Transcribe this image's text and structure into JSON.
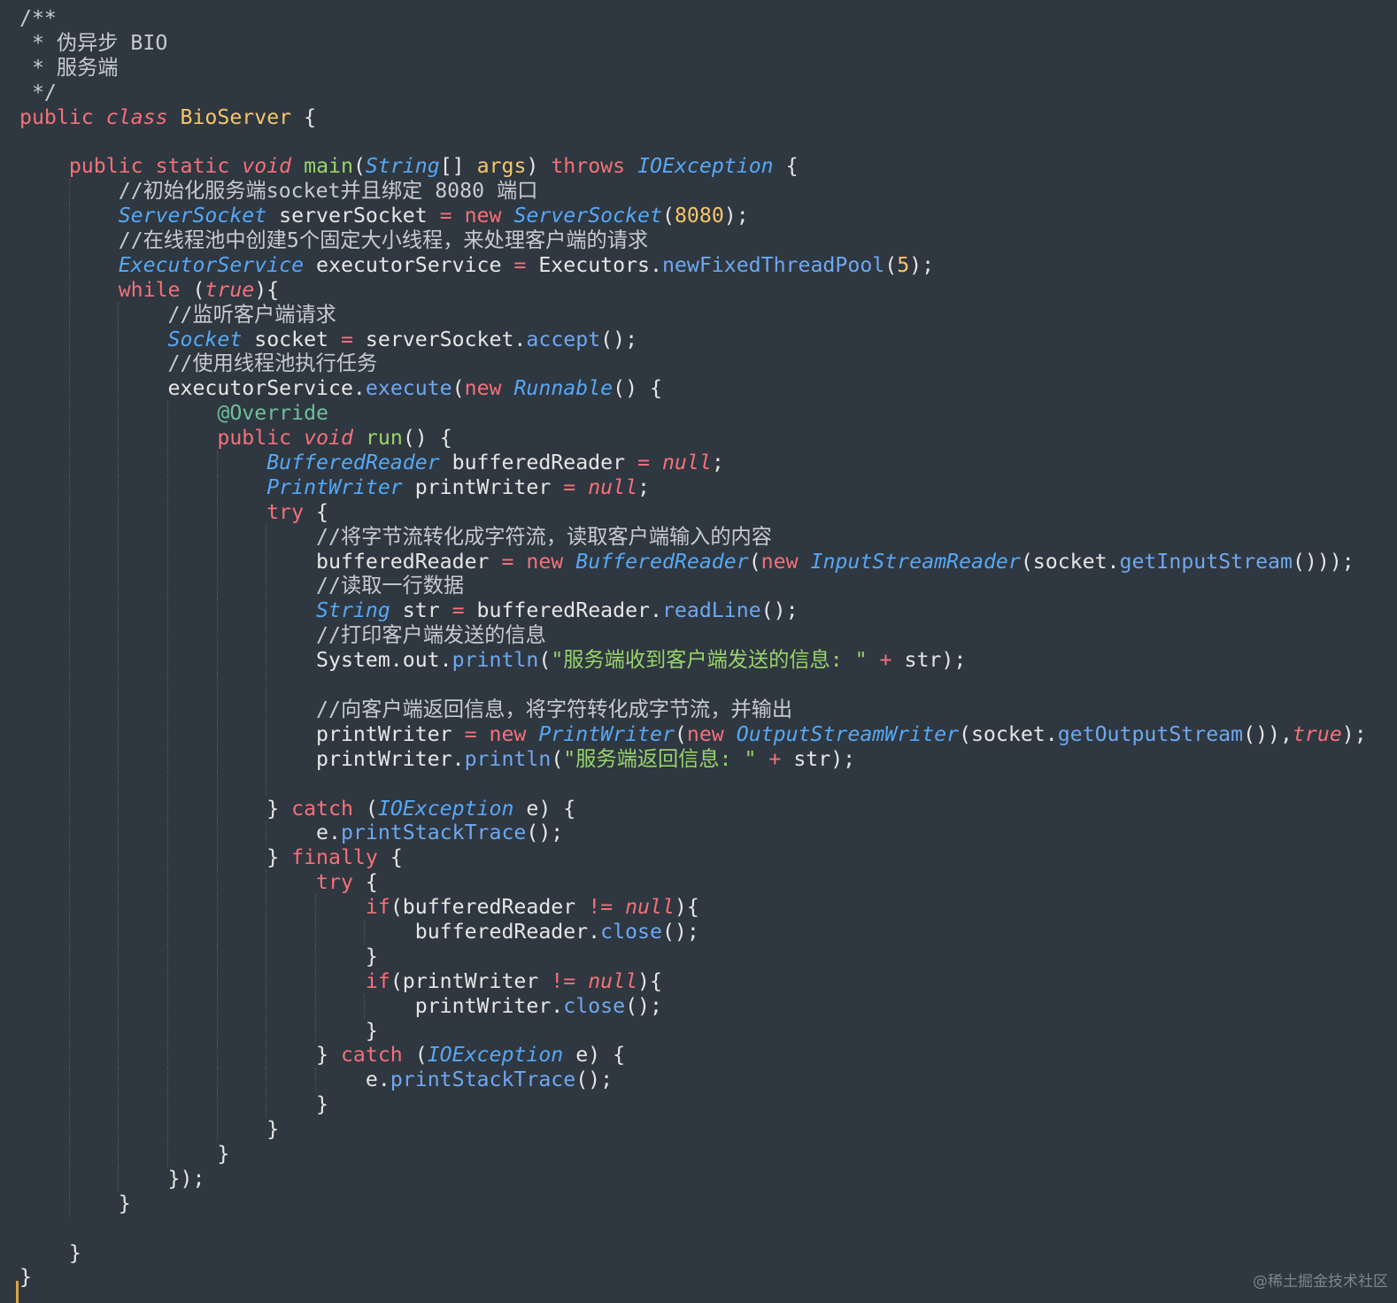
{
  "editor": {
    "language": "Java",
    "indent_size": 4,
    "colors": {
      "background": "#2f3740",
      "keyword": "#f5707a",
      "type": "#56a8f5",
      "method": "#6ea8f0",
      "declaration": "#9bd66b",
      "class_name": "#f7c66a",
      "number": "#f7c66a",
      "string": "#98d46c",
      "comment": "#c7cbd1",
      "annotation": "#6fbf9a",
      "plain": "#e6e6e6",
      "indent_guide": "#4f5863",
      "left_marker": "#d9a445"
    },
    "lines": [
      {
        "indent": 0,
        "tokens": [
          [
            "cm",
            "/**"
          ]
        ]
      },
      {
        "indent": 0,
        "tokens": [
          [
            "cm",
            " * 伪异步 BIO"
          ]
        ]
      },
      {
        "indent": 0,
        "tokens": [
          [
            "cm",
            " * 服务端"
          ]
        ]
      },
      {
        "indent": 0,
        "tokens": [
          [
            "cm",
            " */"
          ]
        ]
      },
      {
        "indent": 0,
        "tokens": [
          [
            "kw",
            "public "
          ],
          [
            "it",
            "class "
          ],
          [
            "cl",
            "BioServer"
          ],
          [
            "pl",
            " {"
          ]
        ]
      },
      {
        "indent": 0,
        "tokens": []
      },
      {
        "indent": 1,
        "tokens": [
          [
            "kw",
            "public static "
          ],
          [
            "it",
            "void "
          ],
          [
            "fm",
            "main"
          ],
          [
            "pl",
            "("
          ],
          [
            "ty",
            "String"
          ],
          [
            "pl",
            "[] "
          ],
          [
            "ar",
            "args"
          ],
          [
            "pl",
            ") "
          ],
          [
            "kw",
            "throws "
          ],
          [
            "ty",
            "IOException"
          ],
          [
            "pl",
            " {"
          ]
        ]
      },
      {
        "indent": 2,
        "tokens": [
          [
            "cm",
            "//初始化服务端socket并且绑定 8080 端口"
          ]
        ]
      },
      {
        "indent": 2,
        "tokens": [
          [
            "ty",
            "ServerSocket"
          ],
          [
            "pl",
            " serverSocket "
          ],
          [
            "op",
            "="
          ],
          [
            "kw",
            " new "
          ],
          [
            "ty",
            "ServerSocket"
          ],
          [
            "pl",
            "("
          ],
          [
            "num",
            "8080"
          ],
          [
            "pl",
            ");"
          ]
        ]
      },
      {
        "indent": 2,
        "tokens": [
          [
            "cm",
            "//在线程池中创建5个固定大小线程，来处理客户端的请求"
          ]
        ]
      },
      {
        "indent": 2,
        "tokens": [
          [
            "ty",
            "ExecutorService"
          ],
          [
            "pl",
            " executorService "
          ],
          [
            "op",
            "="
          ],
          [
            "pl",
            " Executors."
          ],
          [
            "fn",
            "newFixedThreadPool"
          ],
          [
            "pl",
            "("
          ],
          [
            "num",
            "5"
          ],
          [
            "pl",
            ");"
          ]
        ]
      },
      {
        "indent": 2,
        "tokens": [
          [
            "kw",
            "while "
          ],
          [
            "pl",
            "("
          ],
          [
            "it",
            "true"
          ],
          [
            "pl",
            "){"
          ]
        ]
      },
      {
        "indent": 3,
        "tokens": [
          [
            "cm",
            "//监听客户端请求"
          ]
        ]
      },
      {
        "indent": 3,
        "tokens": [
          [
            "ty",
            "Socket"
          ],
          [
            "pl",
            " socket "
          ],
          [
            "op",
            "="
          ],
          [
            "pl",
            " serverSocket."
          ],
          [
            "fn",
            "accept"
          ],
          [
            "pl",
            "();"
          ]
        ]
      },
      {
        "indent": 3,
        "tokens": [
          [
            "cm",
            "//使用线程池执行任务"
          ]
        ]
      },
      {
        "indent": 3,
        "tokens": [
          [
            "pl",
            "executorService."
          ],
          [
            "fn",
            "execute"
          ],
          [
            "pl",
            "("
          ],
          [
            "kw",
            "new "
          ],
          [
            "ty",
            "Runnable"
          ],
          [
            "pl",
            "() {"
          ]
        ]
      },
      {
        "indent": 4,
        "tokens": [
          [
            "an",
            "@Override"
          ]
        ]
      },
      {
        "indent": 4,
        "tokens": [
          [
            "kw",
            "public "
          ],
          [
            "it",
            "void "
          ],
          [
            "fm",
            "run"
          ],
          [
            "pl",
            "() {"
          ]
        ]
      },
      {
        "indent": 5,
        "tokens": [
          [
            "ty",
            "BufferedReader"
          ],
          [
            "pl",
            " bufferedReader "
          ],
          [
            "op",
            "="
          ],
          [
            "pl",
            " "
          ],
          [
            "it",
            "null"
          ],
          [
            "pl",
            ";"
          ]
        ]
      },
      {
        "indent": 5,
        "tokens": [
          [
            "ty",
            "PrintWriter"
          ],
          [
            "pl",
            " printWriter "
          ],
          [
            "op",
            "="
          ],
          [
            "pl",
            " "
          ],
          [
            "it",
            "null"
          ],
          [
            "pl",
            ";"
          ]
        ]
      },
      {
        "indent": 5,
        "tokens": [
          [
            "kw",
            "try "
          ],
          [
            "pl",
            "{"
          ]
        ]
      },
      {
        "indent": 6,
        "tokens": [
          [
            "cm",
            "//将字节流转化成字符流，读取客户端输入的内容"
          ]
        ]
      },
      {
        "indent": 6,
        "tokens": [
          [
            "pl",
            "bufferedReader "
          ],
          [
            "op",
            "="
          ],
          [
            "kw",
            " new "
          ],
          [
            "ty",
            "BufferedReader"
          ],
          [
            "pl",
            "("
          ],
          [
            "kw",
            "new "
          ],
          [
            "ty",
            "InputStreamReader"
          ],
          [
            "pl",
            "(socket."
          ],
          [
            "fn",
            "getInputStream"
          ],
          [
            "pl",
            "()));"
          ]
        ]
      },
      {
        "indent": 6,
        "tokens": [
          [
            "cm",
            "//读取一行数据"
          ]
        ]
      },
      {
        "indent": 6,
        "tokens": [
          [
            "ty",
            "String"
          ],
          [
            "pl",
            " str "
          ],
          [
            "op",
            "="
          ],
          [
            "pl",
            " bufferedReader."
          ],
          [
            "fn",
            "readLine"
          ],
          [
            "pl",
            "();"
          ]
        ]
      },
      {
        "indent": 6,
        "tokens": [
          [
            "cm",
            "//打印客户端发送的信息"
          ]
        ]
      },
      {
        "indent": 6,
        "tokens": [
          [
            "pl",
            "System.out."
          ],
          [
            "fn",
            "println"
          ],
          [
            "pl",
            "("
          ],
          [
            "str",
            "\"服务端收到客户端发送的信息: \""
          ],
          [
            "op",
            " + "
          ],
          [
            "pl",
            "str);"
          ]
        ]
      },
      {
        "indent": 6,
        "tokens": []
      },
      {
        "indent": 6,
        "tokens": [
          [
            "cm",
            "//向客户端返回信息，将字符转化成字节流，并输出"
          ]
        ]
      },
      {
        "indent": 6,
        "tokens": [
          [
            "pl",
            "printWriter "
          ],
          [
            "op",
            "="
          ],
          [
            "kw",
            " new "
          ],
          [
            "ty",
            "PrintWriter"
          ],
          [
            "pl",
            "("
          ],
          [
            "kw",
            "new "
          ],
          [
            "ty",
            "OutputStreamWriter"
          ],
          [
            "pl",
            "(socket."
          ],
          [
            "fn",
            "getOutputStream"
          ],
          [
            "pl",
            "()),"
          ],
          [
            "it",
            "true"
          ],
          [
            "pl",
            ");"
          ]
        ]
      },
      {
        "indent": 6,
        "tokens": [
          [
            "pl",
            "printWriter."
          ],
          [
            "fn",
            "println"
          ],
          [
            "pl",
            "("
          ],
          [
            "str",
            "\"服务端返回信息: \""
          ],
          [
            "op",
            " + "
          ],
          [
            "pl",
            "str);"
          ]
        ]
      },
      {
        "indent": 6,
        "tokens": []
      },
      {
        "indent": 5,
        "tokens": [
          [
            "pl",
            "} "
          ],
          [
            "kw",
            "catch "
          ],
          [
            "pl",
            "("
          ],
          [
            "ty",
            "IOException"
          ],
          [
            "pl",
            " e) {"
          ]
        ]
      },
      {
        "indent": 6,
        "tokens": [
          [
            "pl",
            "e."
          ],
          [
            "fn",
            "printStackTrace"
          ],
          [
            "pl",
            "();"
          ]
        ]
      },
      {
        "indent": 5,
        "tokens": [
          [
            "pl",
            "} "
          ],
          [
            "kw",
            "finally "
          ],
          [
            "pl",
            "{"
          ]
        ]
      },
      {
        "indent": 6,
        "tokens": [
          [
            "kw",
            "try "
          ],
          [
            "pl",
            "{"
          ]
        ]
      },
      {
        "indent": 7,
        "tokens": [
          [
            "kw",
            "if"
          ],
          [
            "pl",
            "(bufferedReader "
          ],
          [
            "op",
            "!="
          ],
          [
            "pl",
            " "
          ],
          [
            "it",
            "null"
          ],
          [
            "pl",
            "){"
          ]
        ]
      },
      {
        "indent": 8,
        "tokens": [
          [
            "pl",
            "bufferedReader."
          ],
          [
            "fn",
            "close"
          ],
          [
            "pl",
            "();"
          ]
        ]
      },
      {
        "indent": 7,
        "tokens": [
          [
            "pl",
            "}"
          ]
        ]
      },
      {
        "indent": 7,
        "tokens": [
          [
            "kw",
            "if"
          ],
          [
            "pl",
            "(printWriter "
          ],
          [
            "op",
            "!="
          ],
          [
            "pl",
            " "
          ],
          [
            "it",
            "null"
          ],
          [
            "pl",
            "){"
          ]
        ]
      },
      {
        "indent": 8,
        "tokens": [
          [
            "pl",
            "printWriter."
          ],
          [
            "fn",
            "close"
          ],
          [
            "pl",
            "();"
          ]
        ]
      },
      {
        "indent": 7,
        "tokens": [
          [
            "pl",
            "}"
          ]
        ]
      },
      {
        "indent": 6,
        "tokens": [
          [
            "pl",
            "} "
          ],
          [
            "kw",
            "catch "
          ],
          [
            "pl",
            "("
          ],
          [
            "ty",
            "IOException"
          ],
          [
            "pl",
            " e) {"
          ]
        ]
      },
      {
        "indent": 7,
        "tokens": [
          [
            "pl",
            "e."
          ],
          [
            "fn",
            "printStackTrace"
          ],
          [
            "pl",
            "();"
          ]
        ]
      },
      {
        "indent": 6,
        "tokens": [
          [
            "pl",
            "}"
          ]
        ]
      },
      {
        "indent": 5,
        "tokens": [
          [
            "pl",
            "}"
          ]
        ]
      },
      {
        "indent": 4,
        "tokens": [
          [
            "pl",
            "}"
          ]
        ]
      },
      {
        "indent": 3,
        "tokens": [
          [
            "pl",
            "});"
          ]
        ]
      },
      {
        "indent": 2,
        "tokens": [
          [
            "pl",
            "}"
          ]
        ]
      },
      {
        "indent": 1,
        "tokens": []
      },
      {
        "indent": 1,
        "tokens": [
          [
            "pl",
            "}"
          ]
        ]
      },
      {
        "indent": 0,
        "tokens": [
          [
            "pl",
            "}"
          ]
        ]
      }
    ]
  },
  "watermark": "@稀土掘金技术社区"
}
